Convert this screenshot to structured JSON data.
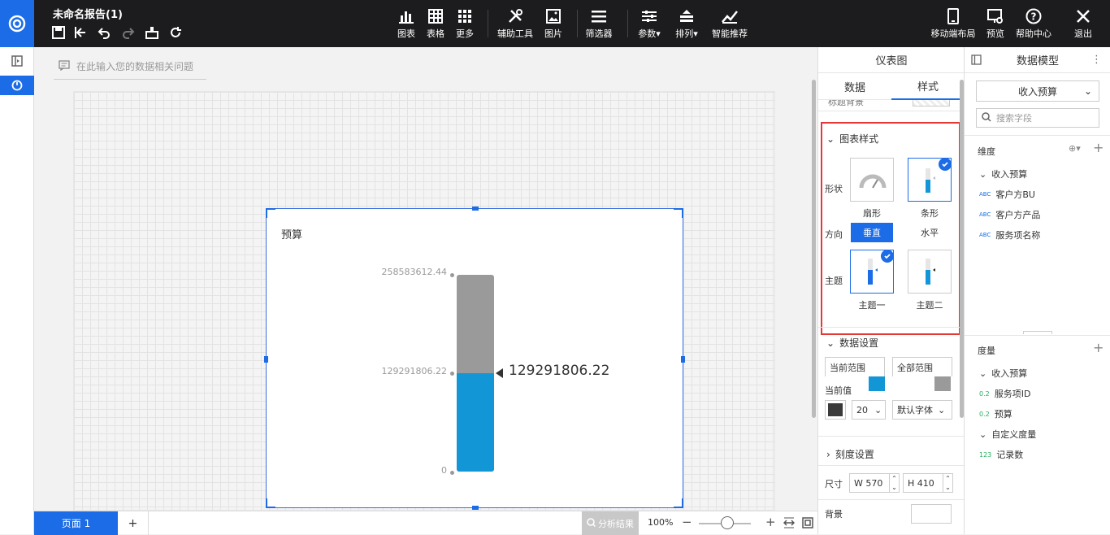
{
  "app": {
    "title": "未命名报告(1)"
  },
  "toolbar": {
    "chart": "图表",
    "table": "表格",
    "more": "更多",
    "aux": "辅助工具",
    "image": "图片",
    "filter": "筛选器",
    "param": "参数",
    "arrange": "排列",
    "smart": "智能推荐",
    "mobile": "移动端布局",
    "preview": "预览",
    "help": "帮助中心",
    "exit": "退出"
  },
  "ask": {
    "placeholder": "在此输入您的数据相关问题"
  },
  "widget": {
    "title": "预算"
  },
  "chart_data": {
    "type": "gauge-bar",
    "title": "预算",
    "ticks": [
      "258583612.44",
      "129291806.22",
      "0"
    ],
    "max": 258583612.44,
    "min": 0,
    "value": 129291806.22,
    "value_label": "129291806.22",
    "colors": {
      "track": "#9a9a9a",
      "fill": "#1296d6"
    }
  },
  "bottom": {
    "page_tab": "页面 1",
    "add": "+",
    "analysis": "分析结果",
    "zoom": "100%",
    "minus": "−",
    "plus": "+"
  },
  "props": {
    "title": "仪表图",
    "tab_data": "数据",
    "tab_style": "样式",
    "title_bg": "标题背景",
    "chart_style": "图表样式",
    "shape_label": "形状",
    "shape_fan": "扇形",
    "shape_bar": "条形",
    "direction_label": "方向",
    "dir_vertical": "垂直",
    "dir_horizontal": "水平",
    "theme_label": "主题",
    "theme1": "主题一",
    "theme2": "主题二",
    "data_settings": "数据设置",
    "current_range": "当前范围",
    "all_range": "全部范围",
    "current_value": "当前值",
    "font_size": "20",
    "font_family": "默认字体",
    "scale_settings": "刻度设置",
    "size_label": "尺寸",
    "width": "W 570",
    "height": "H 410",
    "bg_label": "背景"
  },
  "datamodel": {
    "title": "数据模型",
    "dataset": "收入预算",
    "search_placeholder": "搜索字段",
    "dim_head": "维度",
    "dim_group": "收入预算",
    "dims": [
      "客户方BU",
      "客户方产品",
      "服务项名称"
    ],
    "measure_head": "度量",
    "measure_group": "收入预算",
    "measures": [
      "服务项ID",
      "预算"
    ],
    "custom_group": "自定义度量",
    "custom": [
      "记录数"
    ],
    "dim_tag": "ABC",
    "measure_tag": "0.2",
    "count_tag": "123"
  }
}
